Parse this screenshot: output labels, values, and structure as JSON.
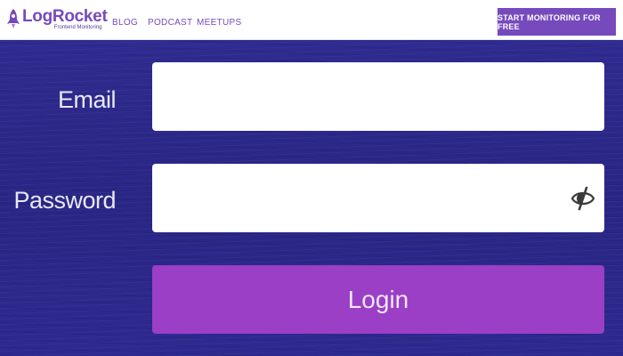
{
  "header": {
    "brand": "LogRocket",
    "tagline": "Frontend Monitoring",
    "nav": [
      "BLOG",
      "PODCAST",
      "MEETUPS"
    ],
    "cta_label": "START MONITORING FOR FREE"
  },
  "form": {
    "email_label": "Email",
    "email_value": "",
    "password_label": "Password",
    "password_value": "",
    "visibility_icon": "eye-slash-icon",
    "login_label": "Login"
  },
  "colors": {
    "brand": "#764abc",
    "background": "#2e2a8c",
    "login_button": "#9a3fc6"
  }
}
